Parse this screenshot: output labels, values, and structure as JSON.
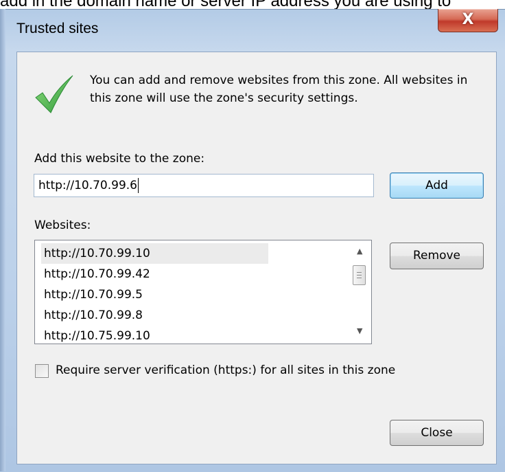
{
  "document": {
    "top_text": "add in the domain name or server IP address you are using to"
  },
  "window": {
    "title": "Trusted sites",
    "close_glyph": "X"
  },
  "info": {
    "message": "You can add and remove websites from this zone. All websites in this zone will use the zone's security settings."
  },
  "add_section": {
    "label": "Add this website to the zone:",
    "input_value": "http://10.70.99.6",
    "add_label": "Add"
  },
  "websites": {
    "label": "Websites:",
    "items": [
      "http://10.70.99.10",
      "http://10.70.99.42",
      "http://10.70.99.5",
      "http://10.70.99.8",
      "http://10.75.99.10"
    ],
    "selected_index": 0,
    "remove_label": "Remove"
  },
  "verification": {
    "label": "Require server verification (https:) for all sites in this zone",
    "checked": false
  },
  "footer": {
    "close_label": "Close"
  },
  "colors": {
    "check_icon": "#3fae49",
    "title_close": "#c0392b",
    "default_button": "#3c7fb1"
  },
  "icons": {
    "check": "green-checkmark-icon",
    "scroll_up": "scroll-up-arrow-icon",
    "scroll_down": "scroll-down-arrow-icon"
  }
}
